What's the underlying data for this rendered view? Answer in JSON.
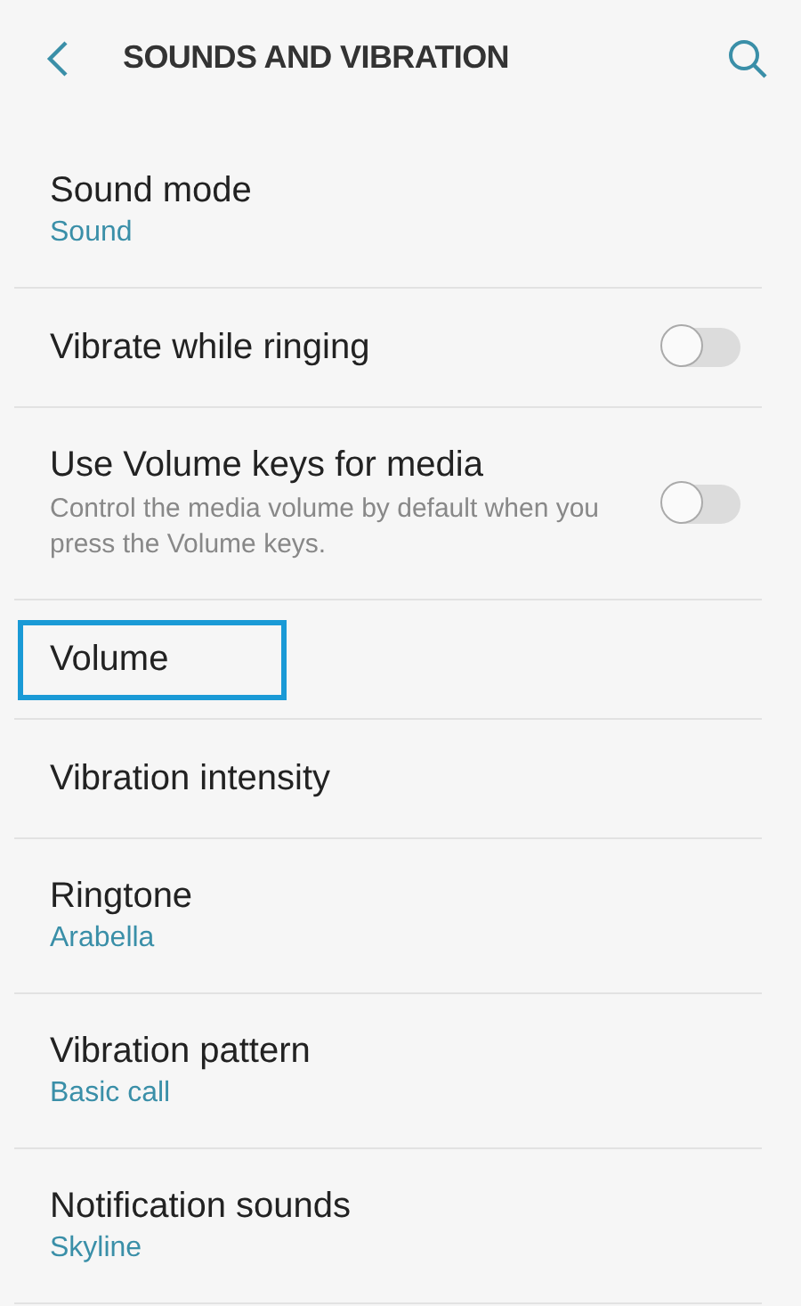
{
  "header": {
    "title": "SOUNDS AND VIBRATION"
  },
  "items": [
    {
      "kind": "link",
      "title": "Sound mode",
      "subtitle": "Sound",
      "highlighted": false
    },
    {
      "kind": "switch",
      "title": "Vibrate while ringing",
      "on": false,
      "highlighted": false
    },
    {
      "kind": "switch",
      "title": "Use Volume keys for media",
      "description": "Control the media volume by default when you press the Volume keys.",
      "on": false,
      "highlighted": false
    },
    {
      "kind": "link",
      "title": "Volume",
      "highlighted": true
    },
    {
      "kind": "link",
      "title": "Vibration intensity",
      "highlighted": false
    },
    {
      "kind": "link",
      "title": "Ringtone",
      "subtitle": "Arabella",
      "highlighted": false
    },
    {
      "kind": "link",
      "title": "Vibration pattern",
      "subtitle": "Basic call",
      "highlighted": false
    },
    {
      "kind": "link",
      "title": "Notification sounds",
      "subtitle": "Skyline",
      "highlighted": false
    }
  ]
}
